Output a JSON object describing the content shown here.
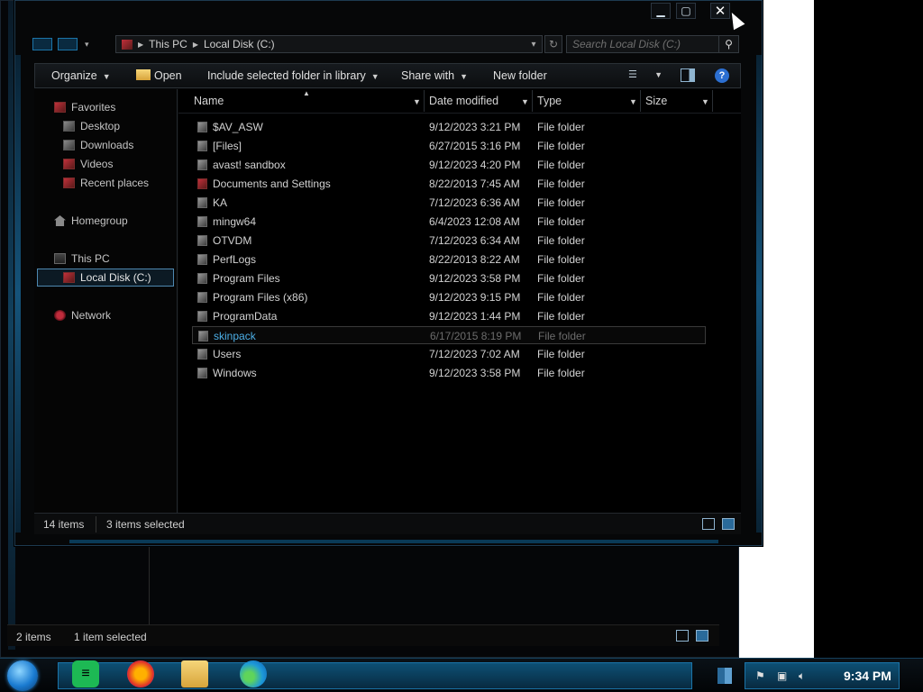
{
  "background_window": {
    "status_items": "2 items",
    "status_selected": "1 item selected"
  },
  "window": {
    "caption": {
      "minimize_icon": "minimize-icon",
      "maximize_icon": "maximize-icon",
      "close_icon": "close-icon"
    },
    "address": {
      "segments": [
        "This PC",
        "Local Disk (C:)"
      ],
      "search_placeholder": "Search Local Disk (C:)"
    },
    "toolbar": {
      "organize": "Organize",
      "open": "Open",
      "include": "Include selected folder in library",
      "share": "Share with",
      "new_folder": "New folder"
    },
    "nav": {
      "favorites": "Favorites",
      "desktop": "Desktop",
      "downloads": "Downloads",
      "videos": "Videos",
      "recent": "Recent places",
      "homegroup": "Homegroup",
      "this_pc": "This PC",
      "local_disk": "Local Disk (C:)",
      "network": "Network"
    },
    "columns": {
      "name": "Name",
      "date": "Date modified",
      "type": "Type",
      "size": "Size"
    },
    "files": [
      {
        "name": "$AV_ASW",
        "date": "9/12/2023 3:21 PM",
        "type": "File folder"
      },
      {
        "name": "[Files]",
        "date": "6/27/2015 3:16 PM",
        "type": "File folder"
      },
      {
        "name": "avast! sandbox",
        "date": "9/12/2023 4:20 PM",
        "type": "File folder"
      },
      {
        "name": "Documents and Settings",
        "date": "8/22/2013 7:45 AM",
        "type": "File folder"
      },
      {
        "name": "KA",
        "date": "7/12/2023 6:36 AM",
        "type": "File folder"
      },
      {
        "name": "mingw64",
        "date": "6/4/2023 12:08 AM",
        "type": "File folder"
      },
      {
        "name": "OTVDM",
        "date": "7/12/2023 6:34 AM",
        "type": "File folder"
      },
      {
        "name": "PerfLogs",
        "date": "8/22/2013 8:22 AM",
        "type": "File folder"
      },
      {
        "name": "Program Files",
        "date": "9/12/2023 3:58 PM",
        "type": "File folder"
      },
      {
        "name": "Program Files (x86)",
        "date": "9/12/2023 9:15 PM",
        "type": "File folder"
      },
      {
        "name": "ProgramData",
        "date": "9/12/2023 1:44 PM",
        "type": "File folder"
      },
      {
        "name": "skinpack",
        "date": "6/17/2015 8:19 PM",
        "type": "File folder"
      },
      {
        "name": "Users",
        "date": "7/12/2023 7:02 AM",
        "type": "File folder"
      },
      {
        "name": "Windows",
        "date": "9/12/2023 3:58 PM",
        "type": "File folder"
      }
    ],
    "status": {
      "items": "14 items",
      "selected": "3 items selected"
    }
  },
  "taskbar": {
    "clock": "9:34 PM",
    "apps": [
      "spotify-icon",
      "firefox-icon",
      "file-explorer-icon",
      "edge-icon"
    ]
  },
  "colors": {
    "accent": "#1b74a8",
    "selection_text": "#4db0e8",
    "help": "#2c6fd1"
  }
}
